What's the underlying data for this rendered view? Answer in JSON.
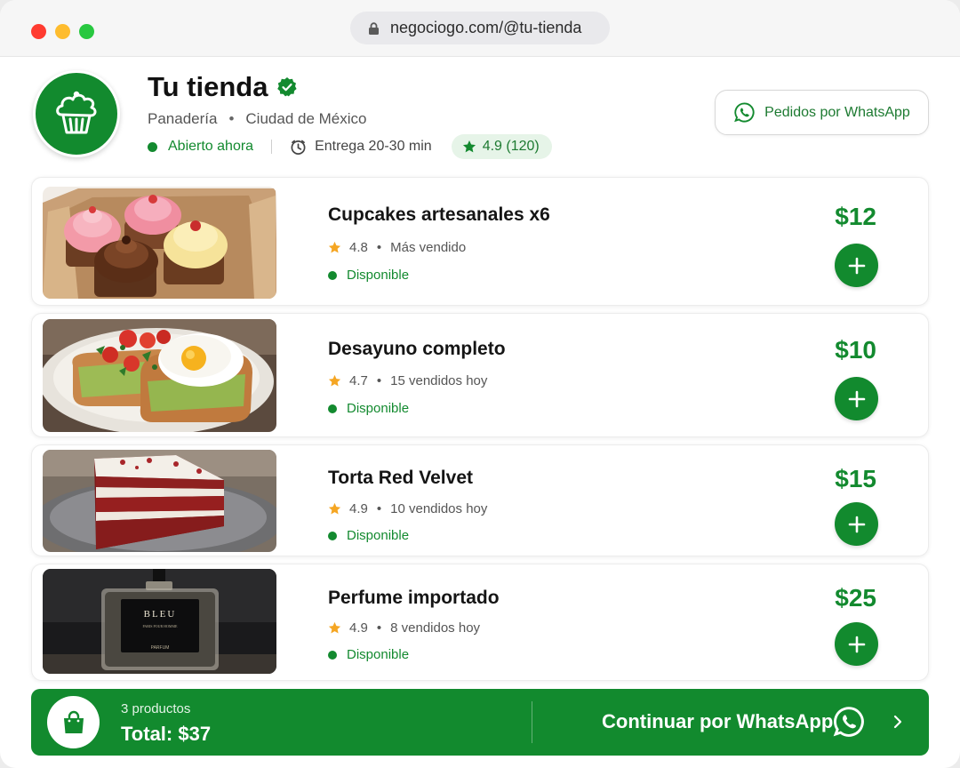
{
  "browser": {
    "url": "negociogo.com/@tu-tienda"
  },
  "store": {
    "name": "Tu tienda",
    "category": "Panadería",
    "separator": "•",
    "city": "Ciudad de México",
    "status": "Abierto ahora",
    "delivery": "Entrega 20-30 min",
    "rating": "4.9 (120)",
    "whatsapp_button": "Pedidos por WhatsApp",
    "logo_icon": "cupcake-icon"
  },
  "colors": {
    "brand_green": "#128a2e",
    "price_green": "#138a2f",
    "star_yellow": "#f5a623",
    "rating_pill_bg": "#e6f4e8"
  },
  "products": [
    {
      "title": "Cupcakes artesanales x6",
      "rating": "4.8",
      "bullet": "•",
      "tag": "Más vendido",
      "availability": "Disponible",
      "price": "$12",
      "image": "cupcakes-box-photo"
    },
    {
      "title": "Desayuno completo",
      "rating": "4.7",
      "bullet": "•",
      "tag": "15 vendidos hoy",
      "availability": "Disponible",
      "price": "$10",
      "image": "avocado-toast-egg-photo"
    },
    {
      "title": "Torta Red Velvet",
      "rating": "4.9",
      "bullet": "•",
      "tag": "10 vendidos hoy",
      "availability": "Disponible",
      "price": "$15",
      "image": "red-velvet-cake-photo"
    },
    {
      "title": "Perfume importado",
      "rating": "4.9",
      "bullet": "•",
      "tag": "8 vendidos hoy",
      "availability": "Disponible",
      "price": "$25",
      "image": "perfume-bottle-photo",
      "image_text": {
        "brand": "BLEU",
        "line": "PARIS POUR HOMME",
        "sub": "PARFUM"
      }
    }
  ],
  "cart": {
    "count": "3 productos",
    "total": "Total: $37",
    "cta": "Continuar por WhatsApp"
  }
}
